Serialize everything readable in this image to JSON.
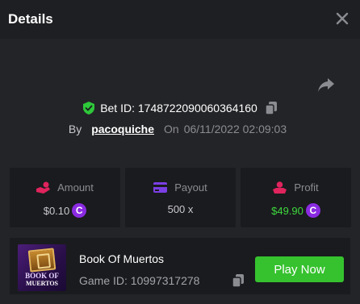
{
  "header": {
    "title": "Details"
  },
  "bet": {
    "id_text": "Bet ID: 1748722090060364160",
    "by_label": "By",
    "username": "pacoquiche",
    "on_label": "On",
    "date": "06/11/2022 02:09:03"
  },
  "stats": {
    "amount": {
      "label": "Amount",
      "value": "$0.10",
      "coin": "C"
    },
    "payout": {
      "label": "Payout",
      "value": "500 x"
    },
    "profit": {
      "label": "Profit",
      "value": "$49.90",
      "coin": "C"
    }
  },
  "game": {
    "thumb_line1": "BOOK OF",
    "thumb_line2": "MUERTOS",
    "name": "Book Of Muertos",
    "id_text": "Game ID: 10997317278",
    "play_label": "Play Now"
  },
  "colors": {
    "accent_green": "#36c22e",
    "profit_green": "#3dd83d",
    "coin_purple": "#8a2be2",
    "amount_icon": "#e0245e",
    "payout_icon": "#7b3fe4",
    "profit_icon": "#e0245e"
  },
  "icons": [
    "close-icon",
    "share-icon",
    "shield-check-icon",
    "copy-icon",
    "hand-coin-icon",
    "credit-card-icon",
    "money-hand-icon"
  ]
}
